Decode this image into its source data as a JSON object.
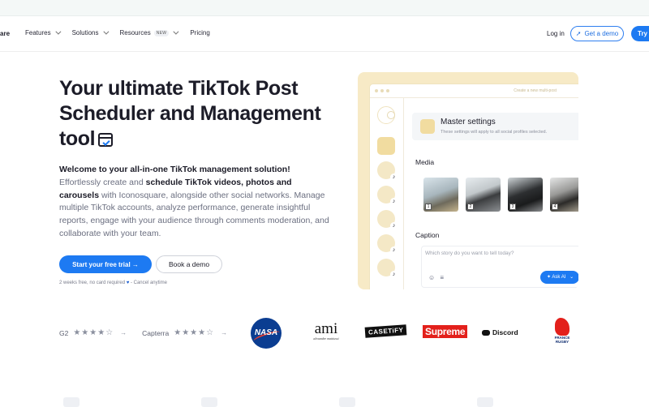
{
  "nav": {
    "brand": "are",
    "menu": [
      {
        "label": "Features",
        "badge": ""
      },
      {
        "label": "Solutions",
        "badge": ""
      },
      {
        "label": "Resources",
        "badge": "NEW"
      },
      {
        "label": "Pricing",
        "badge": ""
      }
    ],
    "login": "Log in",
    "demo": "Get a demo",
    "try": "Try"
  },
  "hero": {
    "title": "Your ultimate TikTok Post Scheduler and Management tool",
    "desc_intro": "Welcome to your all-in-one TikTok management solution!",
    "desc_a": " Effortlessly create and ",
    "desc_bold": "schedule TikTok videos, photos and carousels",
    "desc_b": " with Iconosquare, alongside other social networks. Manage multiple TikTok accounts, analyze performance, generate insightful reports, engage with your audience through comments moderation, and collaborate with your team.",
    "cta_primary": "Start your free trial →",
    "cta_secondary": "Book a demo",
    "fine_a": "2 weeks free, no card required",
    "fine_b": "- Cancel anytime"
  },
  "mock": {
    "window_title": "Create a new multi-post",
    "master_title": "Master settings",
    "master_sub": "These settings will apply to all social profiles selected.",
    "media_label": "Media",
    "thumbs": [
      "1",
      "2",
      "3",
      "4"
    ],
    "caption_label": "Caption",
    "caption_placeholder": "Which story do you want to tell today?",
    "ask_ai": "Ask AI"
  },
  "ratings": {
    "g2": "G2",
    "capterra": "Capterra",
    "stars": "★★★★☆",
    "arrow": "→"
  },
  "logos": {
    "nasa": "NASA",
    "ami": "ami",
    "ami_sub": "alexandre mattiussi",
    "casetify": "CASETiFY",
    "supreme": "Supreme",
    "discord": "Discord",
    "ffr_1": "FRANCE",
    "ffr_2": "RUGBY"
  },
  "colors": {
    "accent": "#1d7af2",
    "mock_bg": "#f7eac6",
    "text": "#1c1c28"
  }
}
